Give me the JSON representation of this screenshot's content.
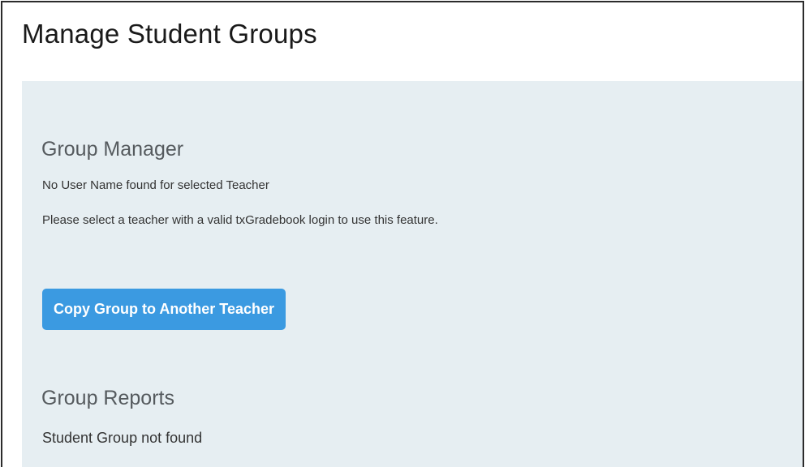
{
  "page": {
    "title": "Manage Student Groups"
  },
  "group_manager": {
    "heading": "Group Manager",
    "message_no_user": "No User Name found for selected Teacher",
    "message_select_teacher": "Please select a teacher with a valid txGradebook login to use this feature.",
    "copy_button_label": "Copy Group to Another Teacher"
  },
  "group_reports": {
    "heading": "Group Reports",
    "message_not_found": "Student Group not found"
  },
  "colors": {
    "panel_background": "#e6eef2",
    "button_background": "#3b9ae1",
    "button_text": "#ffffff",
    "heading_text": "#555a5e"
  }
}
